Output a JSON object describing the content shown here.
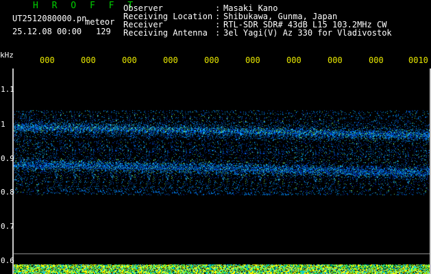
{
  "header": {
    "title": "H R O F F T",
    "filename": "UT2512080000.pn",
    "mode": "meteor",
    "datetime": "25.12.08 00:00",
    "count": "129",
    "fields": [
      {
        "label": "Observer",
        "value": "Masaki Kano"
      },
      {
        "label": "Receiving Location",
        "value": "Shibukawa, Gunma, Japan"
      },
      {
        "label": "Receiver",
        "value": "RTL-SDR SDR# 43dB L15 103.2MHz CW"
      },
      {
        "label": "Receiving Antenna",
        "value": "3el Yagi(V) Az 330 for Vladivostok"
      }
    ],
    "separator": ":"
  },
  "axis": {
    "unit": "kHz",
    "y_ticks": [
      "1.1",
      "1",
      "0.9",
      "0.8",
      "0.7",
      "0.6"
    ],
    "x_ticks": [
      "000",
      "000",
      "000",
      "000",
      "000",
      "000",
      "000",
      "000",
      "000",
      "0010"
    ]
  },
  "colors": {
    "background": "#000000",
    "header_text": "#ffffff",
    "title": "#00d000",
    "ticks": "#e8e800",
    "signal": "#00b0ff"
  }
}
